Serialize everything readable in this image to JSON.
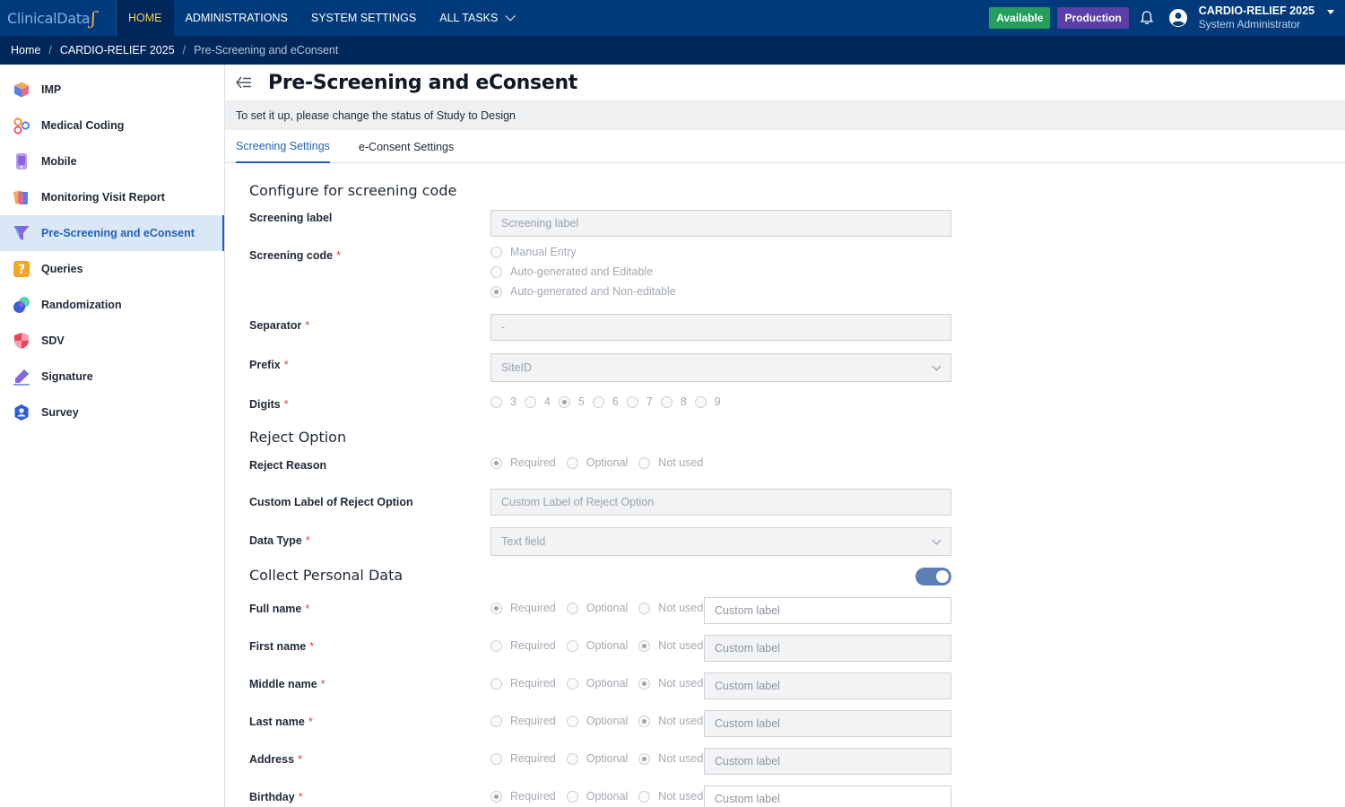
{
  "header": {
    "logo_text": "ClinicalData",
    "nav": [
      {
        "label": "HOME"
      },
      {
        "label": "ADMINISTRATIONS"
      },
      {
        "label": "SYSTEM SETTINGS"
      },
      {
        "label": "ALL TASKS"
      }
    ],
    "status_badge": "Available",
    "env_badge": "Production",
    "user_study": "CARDIO-RELIEF 2025",
    "user_role": "System Administrator"
  },
  "breadcrumb": [
    "Home",
    "CARDIO-RELIEF 2025",
    "Pre-Screening and eConsent"
  ],
  "sidebar": {
    "items": [
      {
        "label": "IMP",
        "icon": "cube-icon"
      },
      {
        "label": "Medical Coding",
        "icon": "molecule-icon"
      },
      {
        "label": "Mobile",
        "icon": "mobile-icon"
      },
      {
        "label": "Monitoring Visit Report",
        "icon": "report-icon"
      },
      {
        "label": "Pre-Screening and eConsent",
        "icon": "funnel-icon"
      },
      {
        "label": "Queries",
        "icon": "question-icon"
      },
      {
        "label": "Randomization",
        "icon": "randomization-icon"
      },
      {
        "label": "SDV",
        "icon": "shield-icon"
      },
      {
        "label": "Signature",
        "icon": "pen-icon"
      },
      {
        "label": "Survey",
        "icon": "survey-icon"
      }
    ],
    "active": "Pre-Screening and eConsent"
  },
  "page": {
    "title": "Pre-Screening and eConsent",
    "notice": "To set it up, please change the status of Study to Design",
    "tabs": [
      "Screening Settings",
      "e-Consent Settings"
    ],
    "active_tab": "Screening Settings"
  },
  "screening": {
    "section_title": "Configure for screening code",
    "screening_label": {
      "label": "Screening label",
      "placeholder": "Screening label"
    },
    "screening_code": {
      "label": "Screening code",
      "options": [
        "Manual Entry",
        "Auto-generated and Editable",
        "Auto-generated and Non-editable"
      ],
      "selected": "Auto-generated and Non-editable"
    },
    "separator": {
      "label": "Separator",
      "value": "-"
    },
    "prefix": {
      "label": "Prefix",
      "value": "SiteID"
    },
    "digits": {
      "label": "Digits",
      "options": [
        "3",
        "4",
        "5",
        "6",
        "7",
        "8",
        "9"
      ],
      "selected": "5"
    }
  },
  "reject": {
    "section_title": "Reject Option",
    "reason": {
      "label": "Reject Reason",
      "options": [
        "Required",
        "Optional",
        "Not used"
      ],
      "selected": "Required"
    },
    "custom_label": {
      "label": "Custom Label of Reject Option",
      "placeholder": "Custom Label of Reject Option"
    },
    "data_type": {
      "label": "Data Type",
      "value": "Text field"
    }
  },
  "personal": {
    "section_title": "Collect Personal Data",
    "toggle_on": true,
    "options": [
      "Required",
      "Optional",
      "Not used"
    ],
    "custom_placeholder": "Custom label",
    "fields": [
      {
        "label": "Full name",
        "selected": "Required"
      },
      {
        "label": "First name",
        "selected": "Not used"
      },
      {
        "label": "Middle name",
        "selected": "Not used"
      },
      {
        "label": "Last name",
        "selected": "Not used"
      },
      {
        "label": "Address",
        "selected": "Not used"
      },
      {
        "label": "Birthday",
        "selected": "Required"
      }
    ]
  },
  "colors": {
    "topbar": "#003a7a",
    "accent": "#1f63b8",
    "available": "#22a05a",
    "production": "#5a3fa8"
  }
}
